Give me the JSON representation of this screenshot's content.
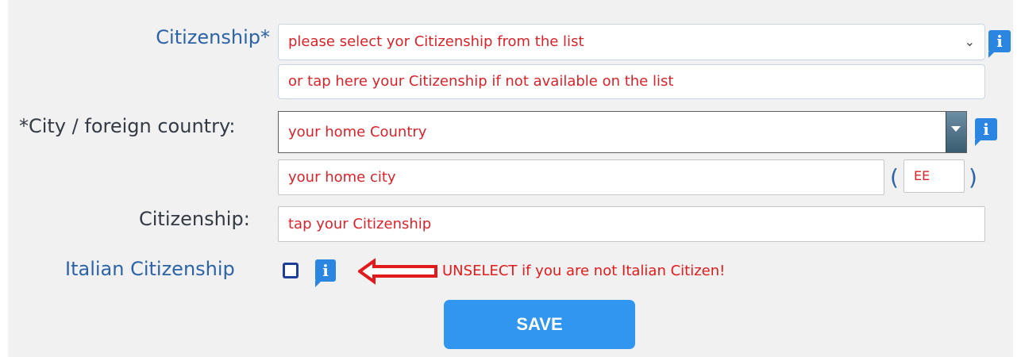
{
  "form": {
    "citizenship_required": {
      "label": "Citizenship",
      "required_mark": "*",
      "select_value": "please select yor Citizenship from the list",
      "other_input_value": "or tap here your Citizenship if not available on the list",
      "info_icon": "info-icon"
    },
    "city_country": {
      "label": "*City / foreign country:",
      "country_value": "your home Country",
      "city_value": "your home city",
      "code_value": "EE",
      "paren_open": "(",
      "paren_close": ")",
      "info_icon": "info-icon"
    },
    "citizenship_text": {
      "label": "Citizenship:",
      "value": "tap your Citizenship"
    },
    "italian_citizenship": {
      "label": "Italian Citizenship",
      "checked": false,
      "info_icon": "info-icon",
      "arrow_icon": "left-arrow-icon",
      "warning": "UNSELECT if you are not Italian Citizen!"
    },
    "info_glyph": "i",
    "save_label": "SAVE"
  },
  "colors": {
    "label_blue": "#2c63a6",
    "field_text_red": "#d9232b",
    "info_blue": "#2a86e1",
    "save_blue": "#3196ef",
    "warning_red": "#e11b1b",
    "panel_bg": "#f1f1f1"
  }
}
